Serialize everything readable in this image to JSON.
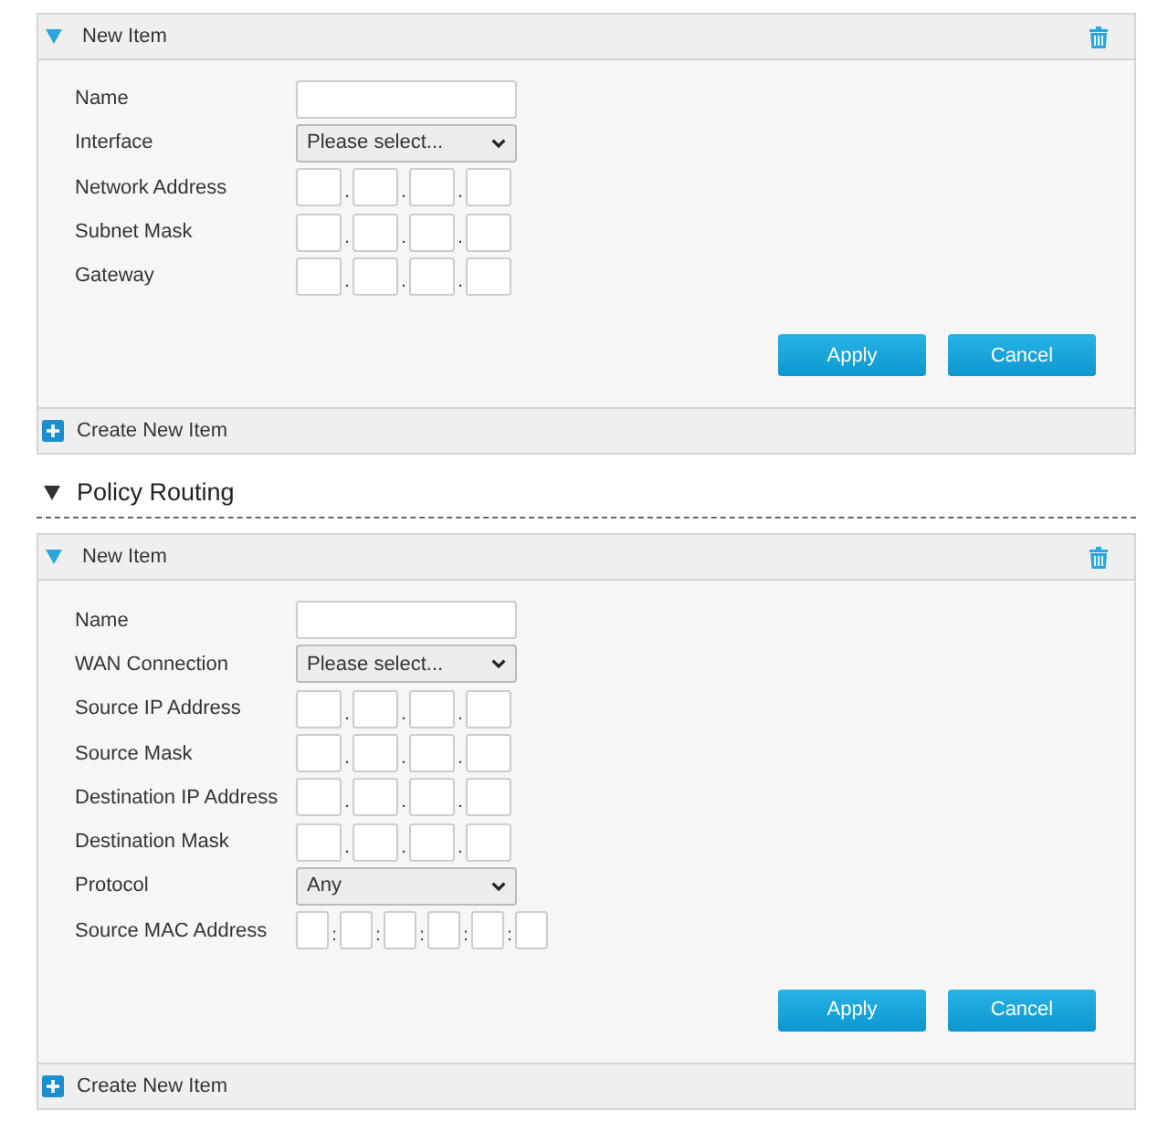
{
  "sections": [
    {
      "panel": {
        "title": "New Item",
        "expanded": true,
        "fields": [
          {
            "kind": "text",
            "label": "Name"
          },
          {
            "kind": "select",
            "label": "Interface",
            "value": "Please select..."
          },
          {
            "kind": "ip",
            "label": "Network Address",
            "separators": [
              ".",
              ".",
              "."
            ]
          },
          {
            "kind": "ip",
            "label": "Subnet Mask",
            "separators": [
              ".",
              ".",
              "."
            ]
          },
          {
            "kind": "ip",
            "label": "Gateway",
            "separators": [
              ".",
              ".",
              "."
            ]
          }
        ],
        "buttons": [
          "Apply",
          "Cancel"
        ],
        "footer": "Create New Item"
      }
    },
    {
      "heading": {
        "title": "Policy Routing",
        "expanded": true
      },
      "panel": {
        "title": "New Item",
        "expanded": true,
        "fields": [
          {
            "kind": "text",
            "label": "Name"
          },
          {
            "kind": "select",
            "label": "WAN Connection",
            "value": "Please select..."
          },
          {
            "kind": "ip",
            "label": "Source IP Address",
            "separators": [
              ".",
              ".",
              "."
            ]
          },
          {
            "kind": "ip",
            "label": "Source Mask",
            "separators": [
              ".",
              ".",
              "."
            ]
          },
          {
            "kind": "ip",
            "label": "Destination IP Address",
            "separators": [
              ".",
              ".",
              "."
            ]
          },
          {
            "kind": "ip",
            "label": "Destination Mask",
            "separators": [
              ".",
              ".",
              "."
            ]
          },
          {
            "kind": "select",
            "label": "Protocol",
            "value": "Any"
          },
          {
            "kind": "mac",
            "label": "Source MAC Address",
            "separators": [
              ":",
              ":",
              ":",
              ":",
              ":"
            ]
          }
        ],
        "buttons": [
          "Apply",
          "Cancel"
        ],
        "footer": "Create New Item"
      }
    }
  ]
}
